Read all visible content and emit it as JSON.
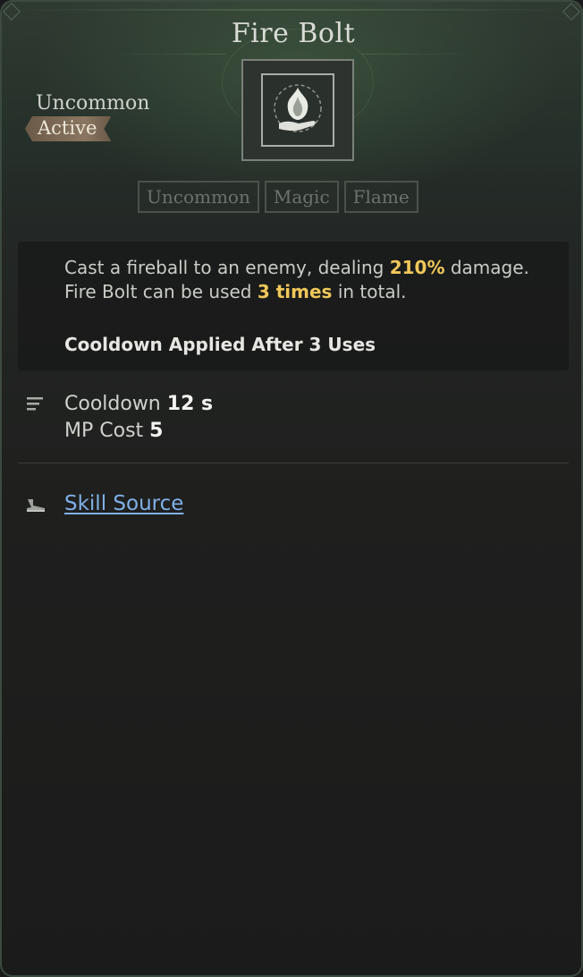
{
  "skill": {
    "title": "Fire Bolt",
    "rarity": "Uncommon",
    "type_badge": "Active",
    "icon": "flame-hand-icon"
  },
  "tags": [
    "Uncommon",
    "Magic",
    "Flame"
  ],
  "description": {
    "part1": "Cast a fireball to an enemy, dealing ",
    "damage": "210%",
    "part2": " damage. Fire Bolt can be used ",
    "uses": "3 times",
    "part3": " in total.",
    "cooldown_note": "Cooldown Applied After 3 Uses"
  },
  "stats": {
    "cooldown_label": "Cooldown",
    "cooldown_value": "12 s",
    "mp_label": "MP Cost",
    "mp_value": "5"
  },
  "source": {
    "link_label": "Skill Source"
  },
  "colors": {
    "highlight": "#f0c75a",
    "link": "#7fb0e6",
    "badge": "#8a7660"
  }
}
